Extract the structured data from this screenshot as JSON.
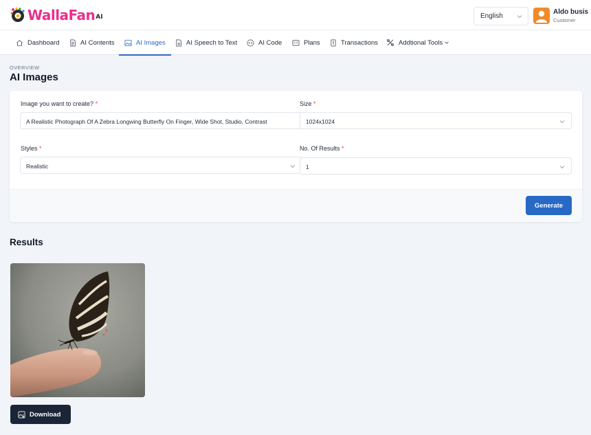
{
  "brand": {
    "name": "WallaFan",
    "suffix": "AI",
    "color": "#ec2f8c"
  },
  "header": {
    "language": "English",
    "user": {
      "name": "Aldo busis",
      "role": "Customer"
    }
  },
  "nav": [
    {
      "label": "Dashboard",
      "icon": "home-icon"
    },
    {
      "label": "AI Contents",
      "icon": "document-icon"
    },
    {
      "label": "AI Images",
      "icon": "image-icon",
      "active": true
    },
    {
      "label": "AI Speech to Text",
      "icon": "audio-file-icon"
    },
    {
      "label": "AI Code",
      "icon": "code-icon"
    },
    {
      "label": "Plans",
      "icon": "plans-icon"
    },
    {
      "label": "Transactions",
      "icon": "receipt-icon"
    },
    {
      "label": "Addtional Tools",
      "icon": "tools-icon",
      "dropdown": true
    }
  ],
  "page": {
    "overline": "OVERVIEW",
    "title": "AI Images"
  },
  "form": {
    "prompt": {
      "label": "Image you want to create?",
      "value": "A Realistic Photograph Of A Zebra Longwing Butterfly On Finger, Wide Shot, Studio, Contrast"
    },
    "size": {
      "label": "Size",
      "value": "1024x1024"
    },
    "styles": {
      "label": "Styles",
      "value": "Realistic"
    },
    "results_count": {
      "label": "No. Of Results",
      "value": "1"
    },
    "required_mark": "*",
    "generate_label": "Generate"
  },
  "results": {
    "title": "Results",
    "download_label": "Download"
  },
  "colors": {
    "accent": "#2769c4",
    "required": "#e0473f",
    "download_bg": "#1b2537",
    "avatar": "#f08a2b"
  }
}
